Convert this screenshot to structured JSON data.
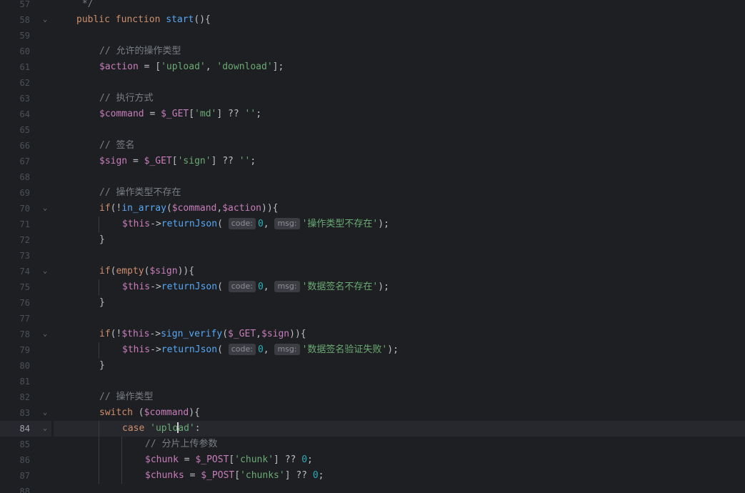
{
  "editor": {
    "current_line": "84",
    "lines": [
      {
        "n": "57",
        "fold": false,
        "indent": 1,
        "tokens": [
          {
            "t": " */",
            "c": "cmt"
          }
        ]
      },
      {
        "n": "58",
        "fold": true,
        "indent": 1,
        "tokens": [
          {
            "t": "public ",
            "c": "kw"
          },
          {
            "t": "function ",
            "c": "kw"
          },
          {
            "t": "start",
            "c": "fn"
          },
          {
            "t": "(){",
            "c": "op"
          }
        ]
      },
      {
        "n": "59",
        "fold": false,
        "indent": 0,
        "tokens": []
      },
      {
        "n": "60",
        "fold": false,
        "indent": 2,
        "tokens": [
          {
            "t": "// 允许的操作类型",
            "c": "cmt"
          }
        ]
      },
      {
        "n": "61",
        "fold": false,
        "indent": 2,
        "tokens": [
          {
            "t": "$action",
            "c": "var"
          },
          {
            "t": " = [",
            "c": "op"
          },
          {
            "t": "'upload'",
            "c": "str"
          },
          {
            "t": ", ",
            "c": "op"
          },
          {
            "t": "'download'",
            "c": "str"
          },
          {
            "t": "];",
            "c": "op"
          }
        ]
      },
      {
        "n": "62",
        "fold": false,
        "indent": 0,
        "tokens": []
      },
      {
        "n": "63",
        "fold": false,
        "indent": 2,
        "tokens": [
          {
            "t": "// 执行方式",
            "c": "cmt"
          }
        ]
      },
      {
        "n": "64",
        "fold": false,
        "indent": 2,
        "tokens": [
          {
            "t": "$command",
            "c": "var"
          },
          {
            "t": " = ",
            "c": "op"
          },
          {
            "t": "$_GET",
            "c": "var"
          },
          {
            "t": "[",
            "c": "op"
          },
          {
            "t": "'md'",
            "c": "str"
          },
          {
            "t": "] ?? ",
            "c": "op"
          },
          {
            "t": "''",
            "c": "str"
          },
          {
            "t": ";",
            "c": "op"
          }
        ]
      },
      {
        "n": "65",
        "fold": false,
        "indent": 0,
        "tokens": []
      },
      {
        "n": "66",
        "fold": false,
        "indent": 2,
        "tokens": [
          {
            "t": "// 签名",
            "c": "cmt"
          }
        ]
      },
      {
        "n": "67",
        "fold": false,
        "indent": 2,
        "tokens": [
          {
            "t": "$sign",
            "c": "var"
          },
          {
            "t": " = ",
            "c": "op"
          },
          {
            "t": "$_GET",
            "c": "var"
          },
          {
            "t": "[",
            "c": "op"
          },
          {
            "t": "'sign'",
            "c": "str"
          },
          {
            "t": "] ?? ",
            "c": "op"
          },
          {
            "t": "''",
            "c": "str"
          },
          {
            "t": ";",
            "c": "op"
          }
        ]
      },
      {
        "n": "68",
        "fold": false,
        "indent": 0,
        "tokens": []
      },
      {
        "n": "69",
        "fold": false,
        "indent": 2,
        "tokens": [
          {
            "t": "// 操作类型不存在",
            "c": "cmt"
          }
        ]
      },
      {
        "n": "70",
        "fold": true,
        "indent": 2,
        "tokens": [
          {
            "t": "if",
            "c": "kw"
          },
          {
            "t": "(!",
            "c": "op"
          },
          {
            "t": "in_array",
            "c": "fn"
          },
          {
            "t": "(",
            "c": "op"
          },
          {
            "t": "$command",
            "c": "var"
          },
          {
            "t": ",",
            "c": "op"
          },
          {
            "t": "$action",
            "c": "var"
          },
          {
            "t": ")){",
            "c": "op"
          }
        ]
      },
      {
        "n": "71",
        "fold": false,
        "indent": 3,
        "tokens": [
          {
            "t": "$this",
            "c": "var"
          },
          {
            "t": "->",
            "c": "op"
          },
          {
            "t": "returnJson",
            "c": "fn"
          },
          {
            "t": "( ",
            "c": "op"
          },
          {
            "h": "code:"
          },
          {
            "t": "0",
            "c": "num"
          },
          {
            "t": ", ",
            "c": "op"
          },
          {
            "h": "msg:"
          },
          {
            "t": "'操作类型不存在'",
            "c": "str"
          },
          {
            "t": ");",
            "c": "op"
          }
        ]
      },
      {
        "n": "72",
        "fold": false,
        "indent": 2,
        "tokens": [
          {
            "t": "}",
            "c": "op"
          }
        ]
      },
      {
        "n": "73",
        "fold": false,
        "indent": 0,
        "tokens": []
      },
      {
        "n": "74",
        "fold": true,
        "indent": 2,
        "tokens": [
          {
            "t": "if",
            "c": "kw"
          },
          {
            "t": "(",
            "c": "op"
          },
          {
            "t": "empty",
            "c": "kw"
          },
          {
            "t": "(",
            "c": "op"
          },
          {
            "t": "$sign",
            "c": "var"
          },
          {
            "t": ")){",
            "c": "op"
          }
        ]
      },
      {
        "n": "75",
        "fold": false,
        "indent": 3,
        "tokens": [
          {
            "t": "$this",
            "c": "var"
          },
          {
            "t": "->",
            "c": "op"
          },
          {
            "t": "returnJson",
            "c": "fn"
          },
          {
            "t": "( ",
            "c": "op"
          },
          {
            "h": "code:"
          },
          {
            "t": "0",
            "c": "num"
          },
          {
            "t": ", ",
            "c": "op"
          },
          {
            "h": "msg:"
          },
          {
            "t": "'数据签名不存在'",
            "c": "str"
          },
          {
            "t": ");",
            "c": "op"
          }
        ]
      },
      {
        "n": "76",
        "fold": false,
        "indent": 2,
        "tokens": [
          {
            "t": "}",
            "c": "op"
          }
        ]
      },
      {
        "n": "77",
        "fold": false,
        "indent": 0,
        "tokens": []
      },
      {
        "n": "78",
        "fold": true,
        "indent": 2,
        "tokens": [
          {
            "t": "if",
            "c": "kw"
          },
          {
            "t": "(!",
            "c": "op"
          },
          {
            "t": "$this",
            "c": "var"
          },
          {
            "t": "->",
            "c": "op"
          },
          {
            "t": "sign_verify",
            "c": "fn"
          },
          {
            "t": "(",
            "c": "op"
          },
          {
            "t": "$_GET",
            "c": "var"
          },
          {
            "t": ",",
            "c": "op"
          },
          {
            "t": "$sign",
            "c": "var"
          },
          {
            "t": ")){",
            "c": "op"
          }
        ]
      },
      {
        "n": "79",
        "fold": false,
        "indent": 3,
        "tokens": [
          {
            "t": "$this",
            "c": "var"
          },
          {
            "t": "->",
            "c": "op"
          },
          {
            "t": "returnJson",
            "c": "fn"
          },
          {
            "t": "( ",
            "c": "op"
          },
          {
            "h": "code:"
          },
          {
            "t": "0",
            "c": "num"
          },
          {
            "t": ", ",
            "c": "op"
          },
          {
            "h": "msg:"
          },
          {
            "t": "'数据签名验证失败'",
            "c": "str"
          },
          {
            "t": ");",
            "c": "op"
          }
        ]
      },
      {
        "n": "80",
        "fold": false,
        "indent": 2,
        "tokens": [
          {
            "t": "}",
            "c": "op"
          }
        ]
      },
      {
        "n": "81",
        "fold": false,
        "indent": 0,
        "tokens": []
      },
      {
        "n": "82",
        "fold": false,
        "indent": 2,
        "tokens": [
          {
            "t": "// 操作类型",
            "c": "cmt"
          }
        ]
      },
      {
        "n": "83",
        "fold": true,
        "indent": 2,
        "tokens": [
          {
            "t": "switch ",
            "c": "kw"
          },
          {
            "t": "(",
            "c": "op"
          },
          {
            "t": "$command",
            "c": "var"
          },
          {
            "t": "){",
            "c": "op"
          }
        ]
      },
      {
        "n": "84",
        "fold": true,
        "indent": 3,
        "tokens": [
          {
            "t": "case ",
            "c": "kw"
          },
          {
            "t": "'uplo",
            "c": "str"
          },
          {
            "caret": true
          },
          {
            "t": "ad'",
            "c": "str"
          },
          {
            "t": ":",
            "c": "op"
          }
        ]
      },
      {
        "n": "85",
        "fold": false,
        "indent": 4,
        "tokens": [
          {
            "t": "// 分片上传参数",
            "c": "cmt"
          }
        ]
      },
      {
        "n": "86",
        "fold": false,
        "indent": 4,
        "tokens": [
          {
            "t": "$chunk",
            "c": "var"
          },
          {
            "t": " = ",
            "c": "op"
          },
          {
            "t": "$_POST",
            "c": "var"
          },
          {
            "t": "[",
            "c": "op"
          },
          {
            "t": "'chunk'",
            "c": "str"
          },
          {
            "t": "] ?? ",
            "c": "op"
          },
          {
            "t": "0",
            "c": "num"
          },
          {
            "t": ";",
            "c": "op"
          }
        ]
      },
      {
        "n": "87",
        "fold": false,
        "indent": 4,
        "tokens": [
          {
            "t": "$chunks",
            "c": "var"
          },
          {
            "t": " = ",
            "c": "op"
          },
          {
            "t": "$_POST",
            "c": "var"
          },
          {
            "t": "[",
            "c": "op"
          },
          {
            "t": "'chunks'",
            "c": "str"
          },
          {
            "t": "] ?? ",
            "c": "op"
          },
          {
            "t": "0",
            "c": "num"
          },
          {
            "t": ";",
            "c": "op"
          }
        ]
      },
      {
        "n": "88",
        "fold": false,
        "indent": 0,
        "tokens": []
      }
    ]
  }
}
